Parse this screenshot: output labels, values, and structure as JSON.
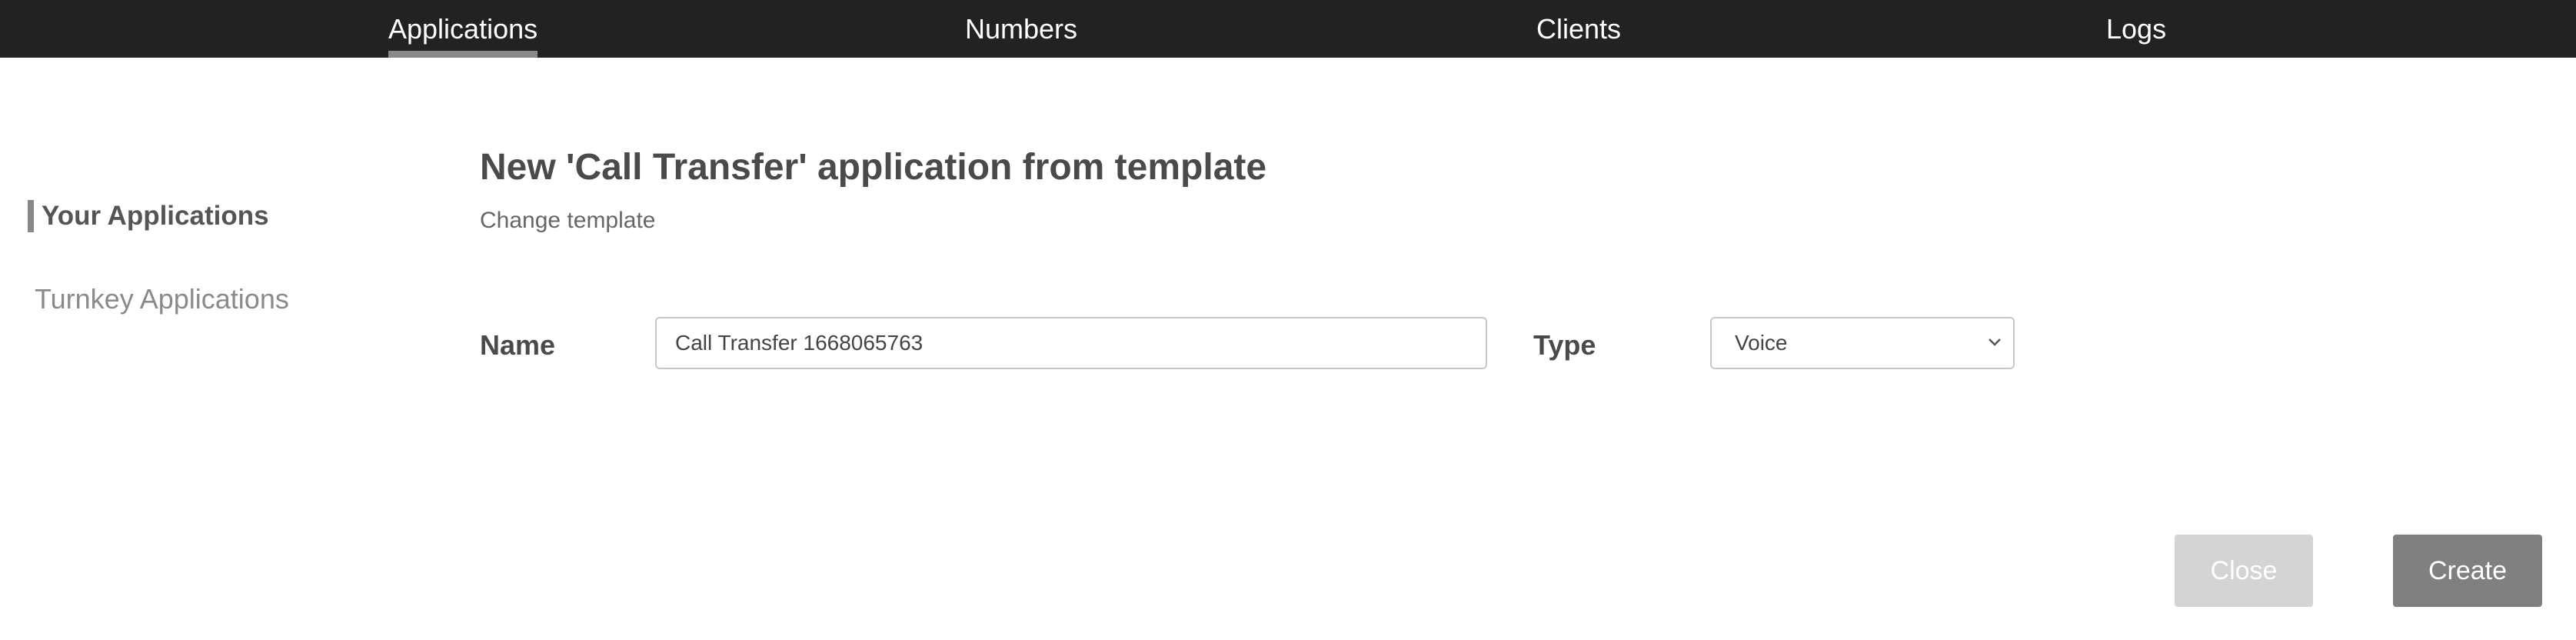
{
  "topnav": {
    "items": [
      {
        "label": "Applications",
        "active": true
      },
      {
        "label": "Numbers",
        "active": false
      },
      {
        "label": "Clients",
        "active": false
      },
      {
        "label": "Logs",
        "active": false
      }
    ]
  },
  "sidebar": {
    "items": [
      {
        "label": "Your Applications",
        "active": true
      },
      {
        "label": "Turnkey Applications",
        "active": false
      }
    ]
  },
  "main": {
    "title": "New 'Call Transfer' application from template",
    "change_template_label": "Change template",
    "name_label": "Name",
    "name_value": "Call Transfer 1668065763",
    "type_label": "Type",
    "type_value": "Voice"
  },
  "actions": {
    "close_label": "Close",
    "create_label": "Create"
  },
  "colors": {
    "nav_bg": "#222222",
    "active_indicator": "#8a8a8a",
    "close_button": "#d4d4d4",
    "create_button": "#808080"
  },
  "icons": {
    "select_chevron": "chevron-down-icon"
  }
}
